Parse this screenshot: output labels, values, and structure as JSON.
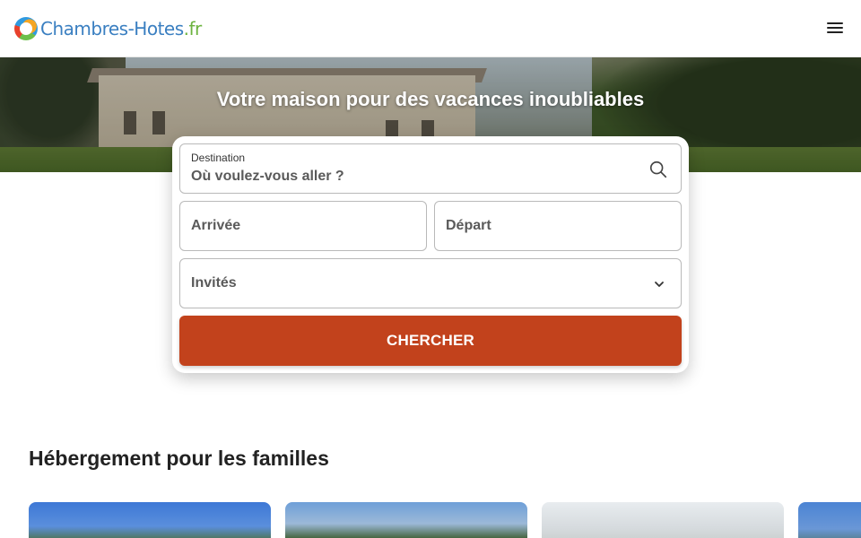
{
  "header": {
    "logo_text": "Chambres-Hotes",
    "logo_tld": ".fr",
    "menu_icon": "hamburger-menu-icon"
  },
  "hero": {
    "title": "Votre maison pour des vacances inoubliables"
  },
  "search": {
    "destination_label": "Destination",
    "destination_placeholder": "Où voulez-vous aller ?",
    "arrival_placeholder": "Arrivée",
    "departure_placeholder": "Départ",
    "guests_placeholder": "Invités",
    "submit_label": "CHERCHER",
    "search_icon": "search-icon",
    "chevron_icon": "chevron-down-icon"
  },
  "section": {
    "title": "Hébergement pour les familles"
  },
  "colors": {
    "accent": "#c2421c",
    "logo_blue": "#3a7fc1",
    "logo_green": "#6cb33f"
  }
}
